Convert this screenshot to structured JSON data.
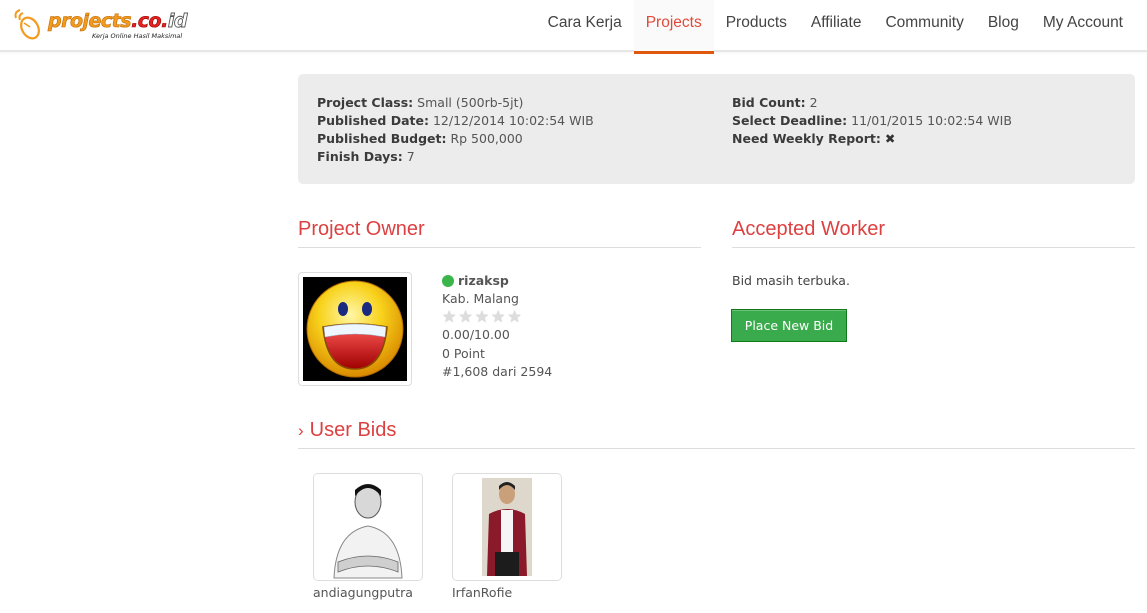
{
  "header": {
    "logo_text_main": "projects",
    "logo_text_dot": ".co.",
    "logo_text_tld": "id",
    "logo_tagline": "Kerja Online Hasil Maksimal",
    "nav": [
      {
        "label": "Cara Kerja",
        "active": false
      },
      {
        "label": "Projects",
        "active": true
      },
      {
        "label": "Products",
        "active": false
      },
      {
        "label": "Affiliate",
        "active": false
      },
      {
        "label": "Community",
        "active": false
      },
      {
        "label": "Blog",
        "active": false
      },
      {
        "label": "My Account",
        "active": false
      }
    ]
  },
  "project_info": {
    "left": [
      {
        "label": "Project Class:",
        "value": "Small (500rb-5jt)"
      },
      {
        "label": "Published Date:",
        "value": "12/12/2014 10:02:54 WIB"
      },
      {
        "label": "Published Budget:",
        "value": "Rp 500,000"
      },
      {
        "label": "Finish Days:",
        "value": "7"
      }
    ],
    "right": [
      {
        "label": "Bid Count:",
        "value": "2"
      },
      {
        "label": "Select Deadline:",
        "value": "11/01/2015 10:02:54 WIB"
      },
      {
        "label": "Need Weekly Report:",
        "value": "✖",
        "icon": "x-mark-icon"
      }
    ]
  },
  "owner": {
    "section_title": "Project Owner",
    "username": "rizaksp",
    "status": "online",
    "location": "Kab. Malang",
    "rating_stars_filled": 0,
    "rating_stars_total": 5,
    "rating": "0.00/10.00",
    "points": "0 Point",
    "rank": "#1,608 dari 2594"
  },
  "worker": {
    "section_title": "Accepted Worker",
    "status_text": "Bid masih terbuka.",
    "button_label": "Place New Bid"
  },
  "bids": {
    "section_title": "User Bids",
    "users": [
      {
        "name": "andiagungputra"
      },
      {
        "name": "IrfanRofie"
      }
    ]
  },
  "colors": {
    "accent_red": "#dd4040",
    "nav_underline": "#e0580e",
    "button_green": "#3aab4c",
    "online_green": "#3ab54a",
    "panel_bg": "#ececec"
  }
}
